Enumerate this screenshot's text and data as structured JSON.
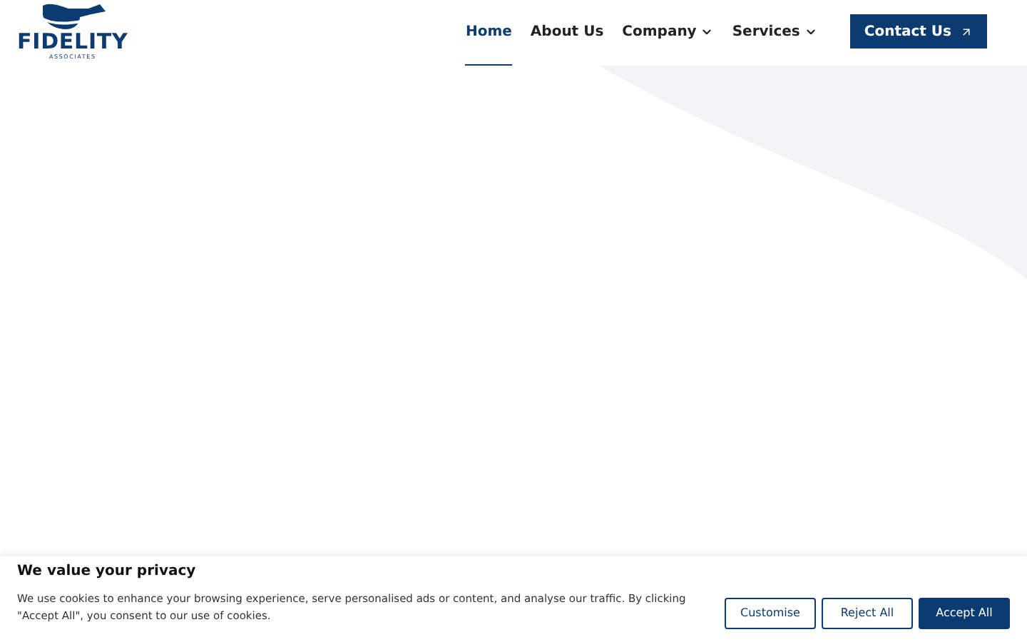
{
  "logo": {
    "name": "FIDELITY",
    "tagline": "ASSOCIATES"
  },
  "nav": [
    {
      "label": "Home",
      "selected": true,
      "dropdown": false
    },
    {
      "label": "About Us",
      "selected": false,
      "dropdown": false
    },
    {
      "label": "Company",
      "selected": false,
      "dropdown": true
    },
    {
      "label": "Services",
      "selected": false,
      "dropdown": true
    }
  ],
  "cta": {
    "label": "Contact Us"
  },
  "cookie_banner": {
    "title": "We value your privacy",
    "text": "We use cookies to enhance your browsing experience, serve personalised ads or content, and analyse our traffic. By clicking \"Accept All\", you consent to our use of cookies.",
    "buttons": [
      {
        "label": "Customise",
        "kind": "outline"
      },
      {
        "label": "Reject All",
        "kind": "outline"
      },
      {
        "label": "Accept All",
        "kind": "primary"
      }
    ]
  }
}
